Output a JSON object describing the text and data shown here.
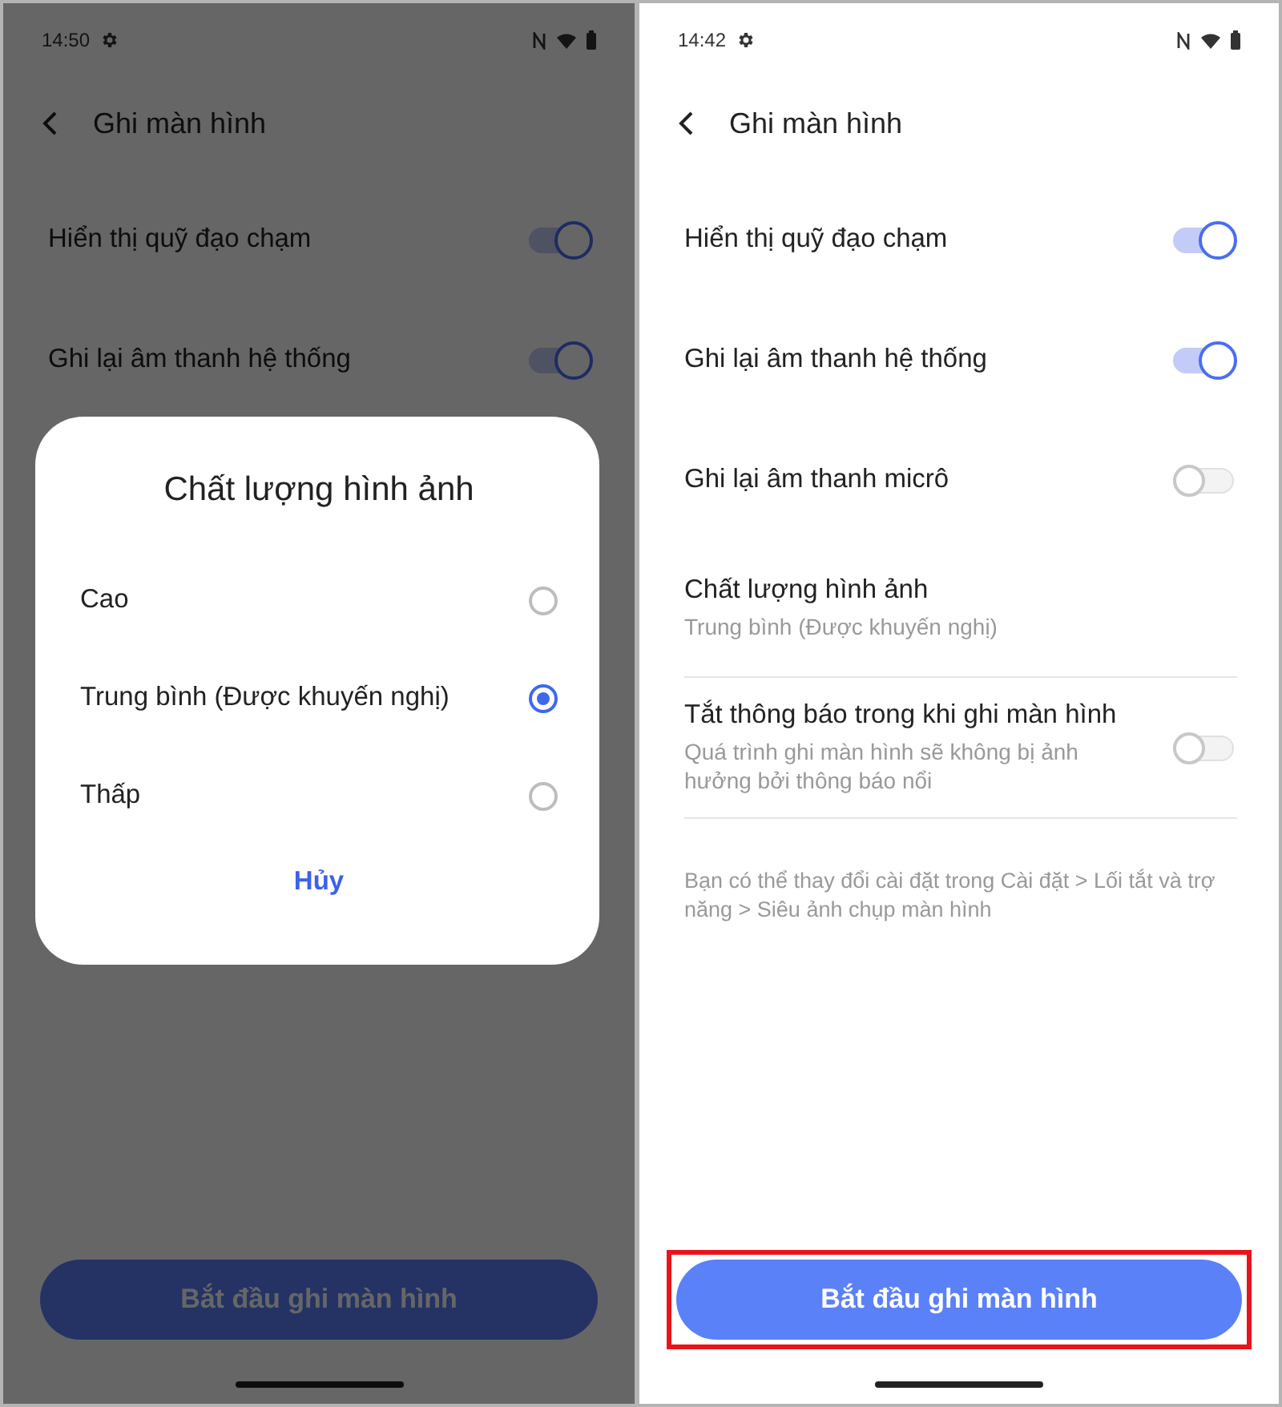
{
  "screens": [
    {
      "dimmed": true,
      "status_time": "14:50",
      "title": "Ghi màn hình",
      "settings": [
        {
          "kind": "toggle",
          "title": "Hiển thị quỹ đạo chạm",
          "on": true
        },
        {
          "kind": "toggle",
          "title": "Ghi lại âm thanh hệ thống",
          "on": true
        }
      ],
      "dialog": {
        "title": "Chất lượng hình ảnh",
        "options": [
          {
            "label": "Cao",
            "selected": false
          },
          {
            "label": "Trung bình (Được khuyến nghị)",
            "selected": true
          },
          {
            "label": "Thấp",
            "selected": false
          }
        ],
        "cancel": "Hủy"
      },
      "start_button": {
        "label": "Bắt đầu ghi màn hình",
        "highlighted": false
      }
    },
    {
      "dimmed": false,
      "status_time": "14:42",
      "title": "Ghi màn hình",
      "settings": [
        {
          "kind": "toggle",
          "title": "Hiển thị quỹ đạo chạm",
          "on": true
        },
        {
          "kind": "toggle",
          "title": "Ghi lại âm thanh hệ thống",
          "on": true
        },
        {
          "kind": "toggle",
          "title": "Ghi lại âm thanh micrô",
          "on": false
        },
        {
          "kind": "value",
          "title": "Chất lượng hình ảnh",
          "subtitle": "Trung bình (Được khuyến nghị)"
        },
        {
          "kind": "toggle",
          "title": "Tắt thông báo trong khi ghi màn hình",
          "subtitle": "Quá trình ghi màn hình sẽ không bị ảnh hưởng bởi thông báo nổi",
          "on": false
        }
      ],
      "note": "Bạn có thể thay đổi cài đặt trong Cài đặt > Lối tắt và trợ năng > Siêu ảnh chụp màn hình",
      "start_button": {
        "label": "Bắt đầu ghi màn hình",
        "highlighted": true
      }
    }
  ]
}
